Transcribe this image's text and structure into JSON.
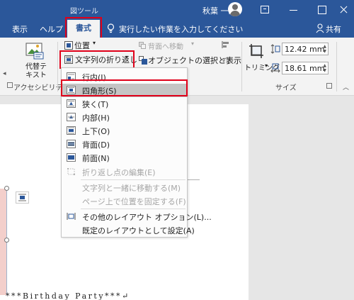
{
  "titlebar": {
    "context_tab": "図ツール",
    "user_name": "秋葉 一郎"
  },
  "tabs": {
    "home": "表示",
    "help": "ヘルプ",
    "format": "書式",
    "tell_me": "実行したい作業を入力してください",
    "share": "共有"
  },
  "ribbon": {
    "alt_text_line1": "代替テ",
    "alt_text_line2": "キスト",
    "accessibility_group": "アクセシビリティ",
    "position": "位置",
    "wrap_text": "文字列の折り返し",
    "bring_forward": "背面へ移動",
    "selection_pane": "オブジェクトの選択と表示",
    "crop": "トリミング",
    "height": "12.42 mm",
    "width": "18.61 mm",
    "size_group": "サイズ"
  },
  "wrap_menu": {
    "items": [
      {
        "label": "行内(I)",
        "disabled": false,
        "selected": false
      },
      {
        "label": "四角形(S)",
        "disabled": false,
        "selected": true
      },
      {
        "label": "狭く(T)",
        "disabled": false,
        "selected": false
      },
      {
        "label": "内部(H)",
        "disabled": false,
        "selected": false
      },
      {
        "label": "上下(O)",
        "disabled": false,
        "selected": false
      },
      {
        "label": "背面(D)",
        "disabled": false,
        "selected": false
      },
      {
        "label": "前面(N)",
        "disabled": false,
        "selected": false
      },
      {
        "label": "折り返し点の編集(E)",
        "disabled": true,
        "selected": false
      },
      {
        "label": "文字列と一緒に移動する(M)",
        "disabled": true,
        "selected": false
      },
      {
        "label": "ページ上で位置を固定する(F)",
        "disabled": true,
        "selected": false
      },
      {
        "label": "その他のレイアウト オプション(L)...",
        "disabled": false,
        "selected": false
      },
      {
        "label": "既定のレイアウトとして設定(A)",
        "disabled": false,
        "selected": false
      }
    ]
  },
  "document": {
    "text": "***Birthday Party***↵"
  },
  "colors": {
    "ribbon_blue": "#2b579a",
    "highlight_red": "#e0001a",
    "ribbon_bg": "#f3f3f3"
  }
}
